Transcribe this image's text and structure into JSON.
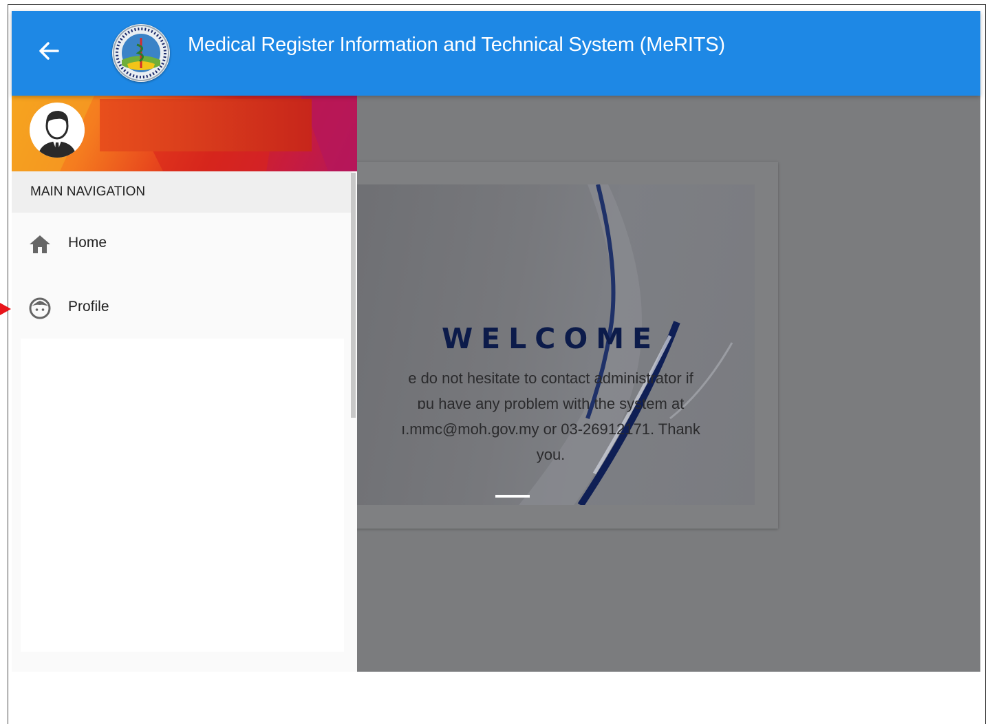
{
  "header": {
    "title": "Medical Register Information and Technical System (MeRITS)",
    "back_icon": "arrow-left-icon",
    "bar_color": "#1e88e5"
  },
  "drawer": {
    "nav_heading": "MAIN NAVIGATION",
    "items": [
      {
        "label": "Home",
        "icon": "home-icon"
      },
      {
        "label": "Profile",
        "icon": "face-icon"
      }
    ]
  },
  "welcome": {
    "title": "WELCOME",
    "lines": [
      "e do not hesitate to contact administrator if",
      "ɒu have any problem with the system at",
      "ı.mmc@moh.gov.my or 03-26912171. Thank",
      "you."
    ]
  },
  "colors": {
    "accent": "#1e88e5",
    "title_navy": "#0c1b4a",
    "pointer_red": "#e8151b"
  }
}
